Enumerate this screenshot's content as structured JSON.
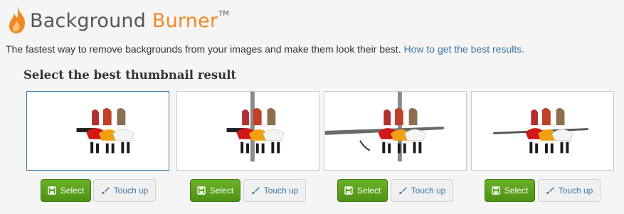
{
  "header": {
    "brand_part1": "Background",
    "brand_part2": "Burner",
    "trademark": "TM",
    "tagline": "The fastest way to remove backgrounds from your images and make them look their best.",
    "help_link": "How to get the best results."
  },
  "section_title": "Select the best thumbnail result",
  "colors": {
    "accent": "#f08a24",
    "link": "#3b76a5",
    "select_green": "#5aa31c"
  },
  "thumbnails": [
    {
      "variant": "clean-cutout",
      "select_label": "Select",
      "touchup_label": "Touch up",
      "selected": true
    },
    {
      "variant": "cutout-with-pillar",
      "select_label": "Select",
      "touchup_label": "Touch up",
      "selected": false
    },
    {
      "variant": "cutout-with-pillar-and-rail",
      "select_label": "Select",
      "touchup_label": "Touch up",
      "selected": false
    },
    {
      "variant": "cutout-with-rail",
      "select_label": "Select",
      "touchup_label": "Touch up",
      "selected": false
    }
  ],
  "icons": {
    "select": "save-icon",
    "touchup": "brush-icon",
    "logo": "flame-icon"
  }
}
